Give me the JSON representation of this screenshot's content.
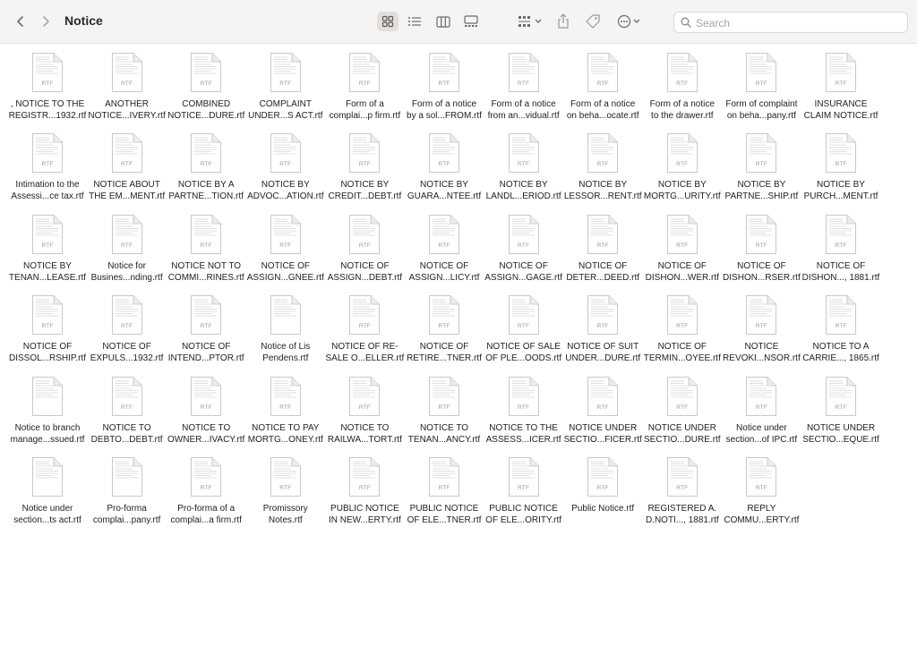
{
  "window": {
    "title": "Notice",
    "search_placeholder": "Search"
  },
  "toolbar": {
    "back_icon": "chevron-left-icon",
    "forward_icon": "chevron-right-icon",
    "views": [
      "icon-view",
      "list-view",
      "column-view",
      "gallery-view"
    ],
    "active_view": "icon-view",
    "group_icon": "group-icon",
    "share_icon": "share-icon",
    "tag_icon": "tag-icon",
    "more_icon": "more-icon"
  },
  "colors": {
    "toolbar_bg": "#f6f4f3",
    "page_bg": "#ffffff",
    "text": "#222222",
    "icon": "#6d6a68"
  },
  "files": [
    {
      "line1": ", NOTICE TO THE",
      "line2": "REGISTR...1932.rtf",
      "ext": "RTF"
    },
    {
      "line1": "ANOTHER",
      "line2": "NOTICE...IVERY.rtf",
      "ext": "RTF"
    },
    {
      "line1": "COMBINED",
      "line2": "NOTICE...DURE.rtf",
      "ext": "RTF"
    },
    {
      "line1": "COMPLAINT",
      "line2": "UNDER...S ACT.rtf",
      "ext": "RTF"
    },
    {
      "line1": "Form of a",
      "line2": "complai...p firm.rtf",
      "ext": "RTF"
    },
    {
      "line1": "Form of a notice",
      "line2": "by a sol...FROM.rtf",
      "ext": "RTF"
    },
    {
      "line1": "Form of a notice",
      "line2": "from an...vidual.rtf",
      "ext": "RTF"
    },
    {
      "line1": "Form of a notice",
      "line2": "on beha...ocate.rtf",
      "ext": "RTF"
    },
    {
      "line1": "Form of a notice",
      "line2": "to the drawer.rtf",
      "ext": "RTF"
    },
    {
      "line1": "Form of complaint",
      "line2": "on beha...pany.rtf",
      "ext": "RTF"
    },
    {
      "line1": "INSURANCE",
      "line2": "CLAIM NOTICE.rtf",
      "ext": "RTF"
    },
    {
      "line1": "Intimation to the",
      "line2": "Assessi...ce tax.rtf",
      "ext": "RTF"
    },
    {
      "line1": "NOTICE ABOUT",
      "line2": "THE EM...MENT.rtf",
      "ext": "RTF"
    },
    {
      "line1": "NOTICE BY A",
      "line2": "PARTNE...TION.rtf",
      "ext": "RTF"
    },
    {
      "line1": "NOTICE BY",
      "line2": "ADVOC...ATION.rtf",
      "ext": "RTF"
    },
    {
      "line1": "NOTICE BY",
      "line2": "CREDIT...DEBT.rtf",
      "ext": "RTF"
    },
    {
      "line1": "NOTICE BY",
      "line2": "GUARA...NTEE.rtf",
      "ext": "RTF"
    },
    {
      "line1": "NOTICE BY",
      "line2": "LANDL...ERIOD.rtf",
      "ext": "RTF"
    },
    {
      "line1": "NOTICE BY",
      "line2": "LESSOR...RENT.rtf",
      "ext": "RTF"
    },
    {
      "line1": "NOTICE BY",
      "line2": "MORTG...URITY.rtf",
      "ext": "RTF"
    },
    {
      "line1": "NOTICE BY",
      "line2": "PARTNE...SHIP.rtf",
      "ext": "RTF"
    },
    {
      "line1": "NOTICE BY",
      "line2": "PURCH...MENT.rtf",
      "ext": "RTF"
    },
    {
      "line1": "NOTICE BY",
      "line2": "TENAN...LEASE.rtf",
      "ext": "RTF"
    },
    {
      "line1": "Notice for",
      "line2": "Busines...nding.rtf",
      "ext": "RTF"
    },
    {
      "line1": "NOTICE NOT TO",
      "line2": "COMMI...RINES.rtf",
      "ext": "RTF"
    },
    {
      "line1": "NOTICE OF",
      "line2": "ASSIGN...GNEE.rtf",
      "ext": "RTF"
    },
    {
      "line1": "NOTICE OF",
      "line2": "ASSIGN...DEBT.rtf",
      "ext": "RTF"
    },
    {
      "line1": "NOTICE OF",
      "line2": "ASSIGN...LICY.rtf",
      "ext": "RTF"
    },
    {
      "line1": "NOTICE OF",
      "line2": "ASSIGN...GAGE.rtf",
      "ext": "RTF"
    },
    {
      "line1": "NOTICE OF",
      "line2": "DETER...DEED.rtf",
      "ext": "RTF"
    },
    {
      "line1": "NOTICE OF",
      "line2": "DISHON...WER.rtf",
      "ext": "RTF"
    },
    {
      "line1": "NOTICE OF",
      "line2": "DISHON...RSER.rtf",
      "ext": "RTF"
    },
    {
      "line1": "NOTICE OF",
      "line2": "DISHON..., 1881.rtf",
      "ext": "RTF"
    },
    {
      "line1": "NOTICE OF",
      "line2": "DISSOL...RSHIP.rtf",
      "ext": "RTF"
    },
    {
      "line1": "NOTICE OF",
      "line2": "EXPULS...1932.rtf",
      "ext": "RTF"
    },
    {
      "line1": "NOTICE OF",
      "line2": "INTEND...PTOR.rtf",
      "ext": "RTF"
    },
    {
      "line1": "Notice of Lis",
      "line2": "Pendens.rtf",
      "ext": ""
    },
    {
      "line1": "NOTICE OF RE-",
      "line2": "SALE O...ELLER.rtf",
      "ext": "RTF"
    },
    {
      "line1": "NOTICE OF",
      "line2": "RETIRE...TNER.rtf",
      "ext": "RTF"
    },
    {
      "line1": "NOTICE OF SALE",
      "line2": "OF PLE...OODS.rtf",
      "ext": "RTF"
    },
    {
      "line1": "NOTICE OF SUIT",
      "line2": "UNDER...DURE.rtf",
      "ext": "RTF"
    },
    {
      "line1": "NOTICE OF",
      "line2": "TERMIN...OYEE.rtf",
      "ext": "RTF"
    },
    {
      "line1": "NOTICE",
      "line2": "REVOKI...NSOR.rtf",
      "ext": "RTF"
    },
    {
      "line1": "NOTICE TO A",
      "line2": "CARRIE..., 1865.rtf",
      "ext": "RTF"
    },
    {
      "line1": "Notice to branch",
      "line2": "manage...ssued.rtf",
      "ext": ""
    },
    {
      "line1": "NOTICE TO",
      "line2": "DEBTO...DEBT.rtf",
      "ext": "RTF"
    },
    {
      "line1": "NOTICE TO",
      "line2": "OWNER...IVACY.rtf",
      "ext": "RTF"
    },
    {
      "line1": "NOTICE TO PAY",
      "line2": "MORTG...ONEY.rtf",
      "ext": "RTF"
    },
    {
      "line1": "NOTICE TO",
      "line2": "RAILWA...TORT.rtf",
      "ext": "RTF"
    },
    {
      "line1": "NOTICE TO",
      "line2": "TENAN...ANCY.rtf",
      "ext": "RTF"
    },
    {
      "line1": "NOTICE TO THE",
      "line2": "ASSESS...ICER.rtf",
      "ext": "RTF"
    },
    {
      "line1": "NOTICE UNDER",
      "line2": "SECTIO...FICER.rtf",
      "ext": "RTF"
    },
    {
      "line1": "NOTICE UNDER",
      "line2": "SECTIO...DURE.rtf",
      "ext": "RTF"
    },
    {
      "line1": "Notice under",
      "line2": "section...of IPC.rtf",
      "ext": "RTF"
    },
    {
      "line1": "NOTICE UNDER",
      "line2": "SECTIO...EQUE.rtf",
      "ext": "RTF"
    },
    {
      "line1": "Notice under",
      "line2": "section...ts act.rtf",
      "ext": ""
    },
    {
      "line1": "Pro-forma",
      "line2": "complai...pany.rtf",
      "ext": ""
    },
    {
      "line1": "Pro-forma of a",
      "line2": "complai...a firm.rtf",
      "ext": "RTF"
    },
    {
      "line1": "Promissory",
      "line2": "Notes.rtf",
      "ext": "RTF"
    },
    {
      "line1": "PUBLIC NOTICE",
      "line2": "IN NEW...ERTY.rtf",
      "ext": "RTF"
    },
    {
      "line1": "PUBLIC NOTICE",
      "line2": "OF ELE...TNER.rtf",
      "ext": "RTF"
    },
    {
      "line1": "PUBLIC NOTICE",
      "line2": "OF ELE...ORITY.rtf",
      "ext": "RTF"
    },
    {
      "line1": "Public Notice.rtf",
      "line2": "",
      "ext": "RTF"
    },
    {
      "line1": "REGISTERED A.",
      "line2": "D.NOTI..., 1881.rtf",
      "ext": "RTF"
    },
    {
      "line1": "REPLY",
      "line2": "COMMU...ERTY.rtf",
      "ext": "RTF"
    }
  ]
}
